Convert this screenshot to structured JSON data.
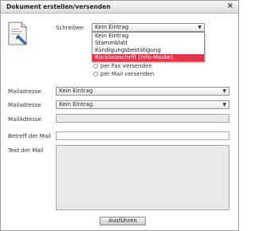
{
  "window": {
    "title": "Dokument erstellen/versenden",
    "close": "×"
  },
  "schreiben": {
    "label": "Schreiben",
    "value": "Kein Eintrag",
    "options": [
      "Kein Eintrag",
      "Stammblatt",
      "Kündigungsbestätigung",
      "Rücklassschrift (Info-Maske)"
    ],
    "selected_index": 3
  },
  "send_options": {
    "fax_label": "per Fax versenden",
    "mail_label": "per Mail versenden"
  },
  "mail1": {
    "label": "Mailadresse",
    "value": "Kein Eintrag"
  },
  "mail2": {
    "label": "Mailadresse",
    "value": "Kein Eintrag"
  },
  "mail3": {
    "label": "MailAdresse",
    "value": ""
  },
  "betreff": {
    "label": "Betreff der Mail",
    "value": ""
  },
  "text": {
    "label": "Text der Mail",
    "value": ""
  },
  "submit": {
    "label": "Ausführen"
  },
  "icons": {
    "document": "document-icon",
    "arrow": "chevron-down-icon"
  }
}
